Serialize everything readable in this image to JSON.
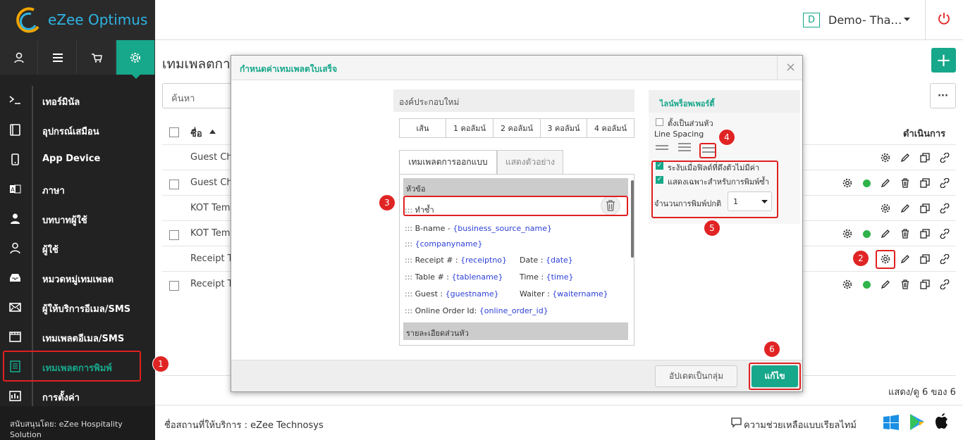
{
  "app": {
    "name": "eZee Optimus",
    "sponsor": "สนับสนุนโดย: eZee Hospitality Solution"
  },
  "sidebar": {
    "items": [
      {
        "label": "เทอร์มินัล",
        "icon": "terminal-icon"
      },
      {
        "label": "อุปกรณ์เสมือน",
        "icon": "tablet-icon"
      },
      {
        "label": "App Device",
        "icon": "mobile-icon"
      },
      {
        "label": "ภาษา",
        "icon": "language-icon"
      },
      {
        "label": "บทบาทผู้ใช้",
        "icon": "user-role-icon"
      },
      {
        "label": "ผู้ใช้",
        "icon": "user-icon"
      },
      {
        "label": "หมวดหมู่เทมเพลต",
        "icon": "inbox-icon"
      },
      {
        "label": "ผู้ให้บริการอีเมล/SMS",
        "icon": "envelope-icon"
      },
      {
        "label": "เทมเพลตอีเมล/SMS",
        "icon": "film-icon"
      },
      {
        "label": "เทมเพลตการพิมพ์",
        "icon": "print-template-icon"
      },
      {
        "label": "การตั้งค่า",
        "icon": "settings-doc-icon"
      }
    ]
  },
  "header": {
    "account_initial": "D",
    "account_name": "Demo- Tha…"
  },
  "page": {
    "title": "เทมเพลตการ",
    "search_placeholder": "ค้นหา",
    "col_name": "ชื่อ",
    "col_actions": "ดำเนินการ",
    "pagination": "แสดง/ดู 6 ของ 6",
    "rows": [
      "Guest Ch",
      "Guest Ch",
      "KOT Tem",
      "KOT Tem",
      "Receipt T",
      "Receipt T"
    ]
  },
  "footer": {
    "provider": "ชื่อสถานที่ให้บริการ : eZee Technosys",
    "help": "ความช่วยเหลือแบบเรียลไทม์"
  },
  "modal": {
    "title": "กำหนดค่าเทมเพลตใบเสร็จ",
    "close": "×",
    "new_component": "องค์ประกอบใหม่",
    "layouts": [
      "เส้น",
      "1 คอลัมน์",
      "2 คอลัมน์",
      "3 คอลัมน์",
      "4 คอลัมน์"
    ],
    "tabs": [
      "เทมเพลตการออกแบบ",
      "แสดงตัวอย่าง"
    ],
    "section_header": "หัวข้อ",
    "section_detail": "รายละเอียดส่วนหัว",
    "field_copy": "ทำซ้ำ",
    "fields": {
      "bname_label": "B-name -",
      "bname_token": "{business_source_name}",
      "company_token": "{companyname}",
      "receipt_label": "Receipt # :",
      "receipt_token": "{receiptno}",
      "date_label": "Date :",
      "date_token": "{date}",
      "table_label": "Table # :",
      "table_token": "{tablename}",
      "time_label": "Time :",
      "time_token": "{time}",
      "guest_label": "Guest :",
      "guest_token": "{guestname}",
      "waiter_label": "Waiter :",
      "waiter_token": "{waitername}",
      "online_label": "Online Order Id:",
      "online_token": "{online_order_id}"
    },
    "props_title": "ไลน์พร็อพเพอร์ตี้",
    "set_header": "ตั้งเป็นส่วนหัว",
    "line_spacing": "Line Spacing",
    "hide_empty": "ระงับเมื่อฟิลด์ที่ดึงตัวไม่มีค่า",
    "print_only": "แสดงเฉพาะสำหรับการพิมพ์ซ้ำ",
    "print_count_label": "จำนวนการพิมพ์ปกติ",
    "print_count_value": "1",
    "update_group": "อัปเดตเป็นกลุ่ม",
    "apply": "แก้ไข"
  },
  "badges": [
    "1",
    "2",
    "3",
    "4",
    "5",
    "6"
  ],
  "colors": {
    "accent": "#17a78a",
    "badge": "#e02424",
    "sidebar": "#222222"
  }
}
